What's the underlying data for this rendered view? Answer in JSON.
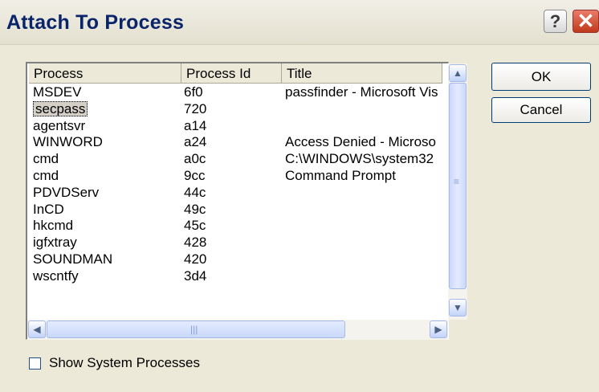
{
  "window": {
    "title": "Attach To Process",
    "help_glyph": "?",
    "close_glyph": "✕"
  },
  "list": {
    "columns": [
      "Process",
      "Process Id",
      "Title"
    ],
    "rows": [
      [
        "MSDEV",
        "6f0",
        "passfinder - Microsoft Vis"
      ],
      [
        "secpass",
        "720",
        ""
      ],
      [
        "agentsvr",
        "a14",
        ""
      ],
      [
        "WINWORD",
        "a24",
        "Access Denied - Microso"
      ],
      [
        "cmd",
        "a0c",
        "C:\\WINDOWS\\system32"
      ],
      [
        "cmd",
        "9cc",
        "Command Prompt"
      ],
      [
        "PDVDServ",
        "44c",
        ""
      ],
      [
        "InCD",
        "49c",
        ""
      ],
      [
        "hkcmd",
        "45c",
        ""
      ],
      [
        "igfxtray",
        "428",
        ""
      ],
      [
        "SOUNDMAN",
        "420",
        ""
      ],
      [
        "wscntfy",
        "3d4",
        ""
      ]
    ],
    "selected_row": 1
  },
  "buttons": {
    "ok": "OK",
    "cancel": "Cancel"
  },
  "checkbox": {
    "label": "Show System Processes",
    "checked": false
  }
}
